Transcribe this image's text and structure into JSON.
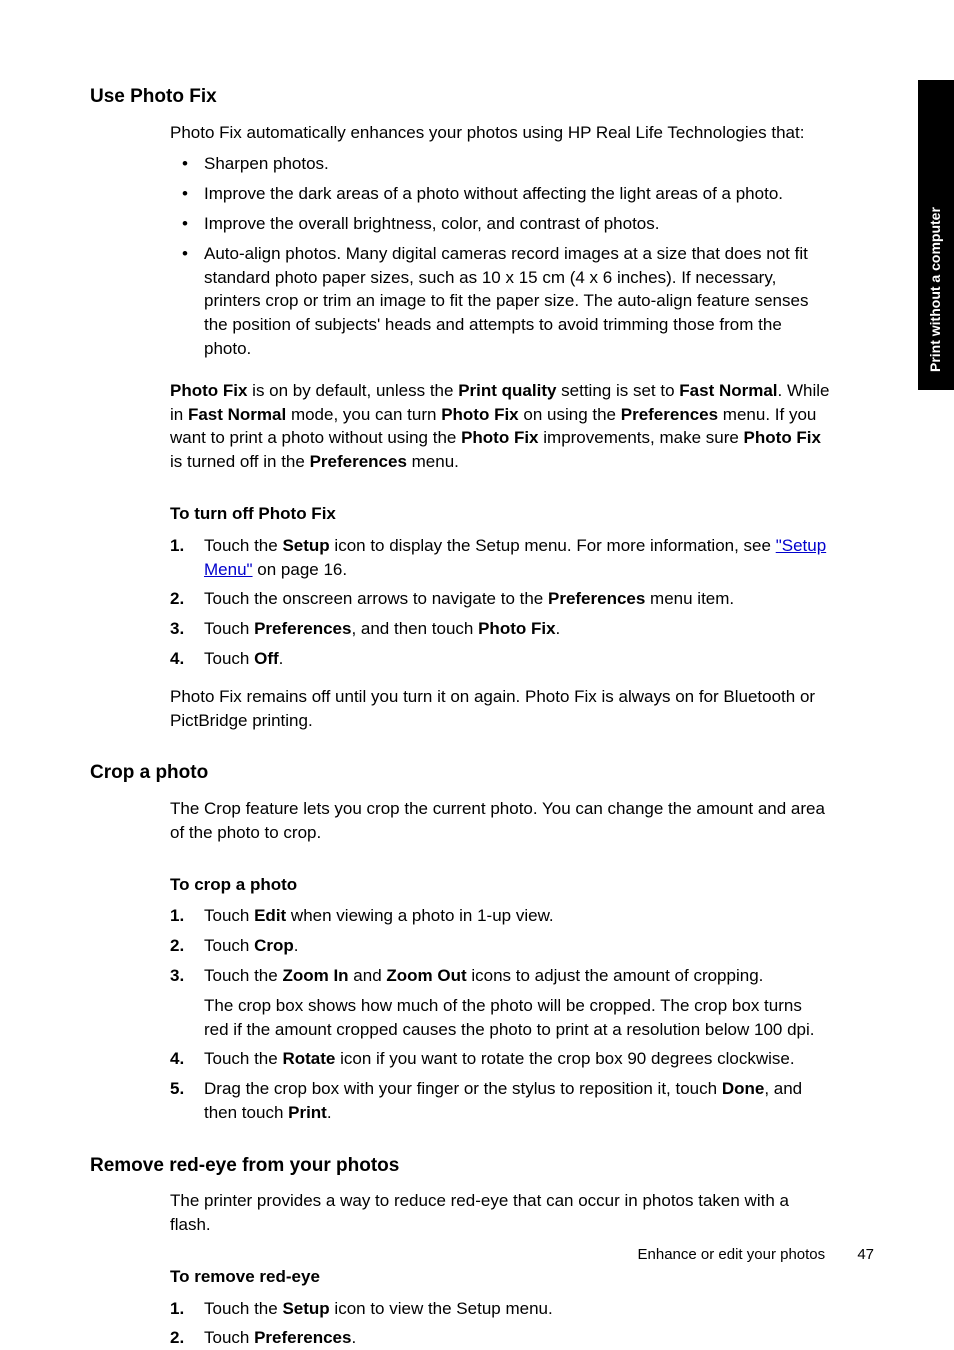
{
  "sideTab": "Print without a computer",
  "sections": {
    "photoFix": {
      "title": "Use Photo Fix",
      "intro": "Photo Fix automatically enhances your photos using HP Real Life Technologies that:",
      "bullets": [
        "Sharpen photos.",
        "Improve the dark areas of a photo without affecting the light areas of a photo.",
        "Improve the overall brightness, color, and contrast of photos.",
        "Auto-align photos. Many digital cameras record images at a size that does not fit standard photo paper sizes, such as 10 x 15 cm (4 x 6 inches). If necessary, printers crop or trim an image to fit the paper size. The auto-align feature senses the position of subjects' heads and attempts to avoid trimming those from the photo."
      ],
      "para": {
        "t1": "Photo Fix",
        "t2": " is on by default, unless the ",
        "t3": "Print quality",
        "t4": " setting is set to ",
        "t5": "Fast Normal",
        "t6": ". While in ",
        "t7": "Fast Normal",
        "t8": " mode, you can turn ",
        "t9": "Photo Fix",
        "t10": " on using the ",
        "t11": "Preferences",
        "t12": " menu. If you want to print a photo without using the ",
        "t13": "Photo Fix",
        "t14": " improvements, make sure ",
        "t15": "Photo Fix",
        "t16": " is turned off in the ",
        "t17": "Preferences",
        "t18": " menu."
      },
      "subhead": "To turn off Photo Fix",
      "step1": {
        "a": "Touch the ",
        "b": "Setup",
        "c": " icon to display the Setup menu. For more information, see ",
        "link": "\"Setup Menu\"",
        "d": " on page 16."
      },
      "step2": {
        "a": "Touch the onscreen arrows to navigate to the ",
        "b": "Preferences",
        "c": " menu item."
      },
      "step3": {
        "a": "Touch ",
        "b": "Preferences",
        "c": ", and then touch ",
        "d": "Photo Fix",
        "e": "."
      },
      "step4": {
        "a": "Touch ",
        "b": "Off",
        "c": "."
      },
      "note": "Photo Fix remains off until you turn it on again. Photo Fix is always on for Bluetooth or PictBridge printing."
    },
    "crop": {
      "title": "Crop a photo",
      "intro": "The Crop feature lets you crop the current photo. You can change the amount and area of the photo to crop.",
      "subhead": "To crop a photo",
      "step1": {
        "a": "Touch ",
        "b": "Edit",
        "c": " when viewing a photo in 1-up view."
      },
      "step2": {
        "a": "Touch ",
        "b": "Crop",
        "c": "."
      },
      "step3": {
        "a": "Touch the ",
        "b": "Zoom In",
        "c": " and ",
        "d": "Zoom Out",
        "e": " icons to adjust the amount of cropping.",
        "sub": "The crop box shows how much of the photo will be cropped. The crop box turns red if the amount cropped causes the photo to print at a resolution below 100 dpi."
      },
      "step4": {
        "a": "Touch the ",
        "b": "Rotate",
        "c": " icon if you want to rotate the crop box 90 degrees clockwise."
      },
      "step5": {
        "a": "Drag the crop box with your finger or the stylus to reposition it, touch ",
        "b": "Done",
        "c": ", and then touch ",
        "d": "Print",
        "e": "."
      }
    },
    "redeye": {
      "title": "Remove red-eye from your photos",
      "intro": "The printer provides a way to reduce red-eye that can occur in photos taken with a flash.",
      "subhead": "To remove red-eye",
      "step1": {
        "a": "Touch the ",
        "b": "Setup",
        "c": " icon to view the Setup menu."
      },
      "step2": {
        "a": "Touch ",
        "b": "Preferences",
        "c": "."
      }
    }
  },
  "footer": {
    "title": "Enhance or edit your photos",
    "page": "47"
  }
}
